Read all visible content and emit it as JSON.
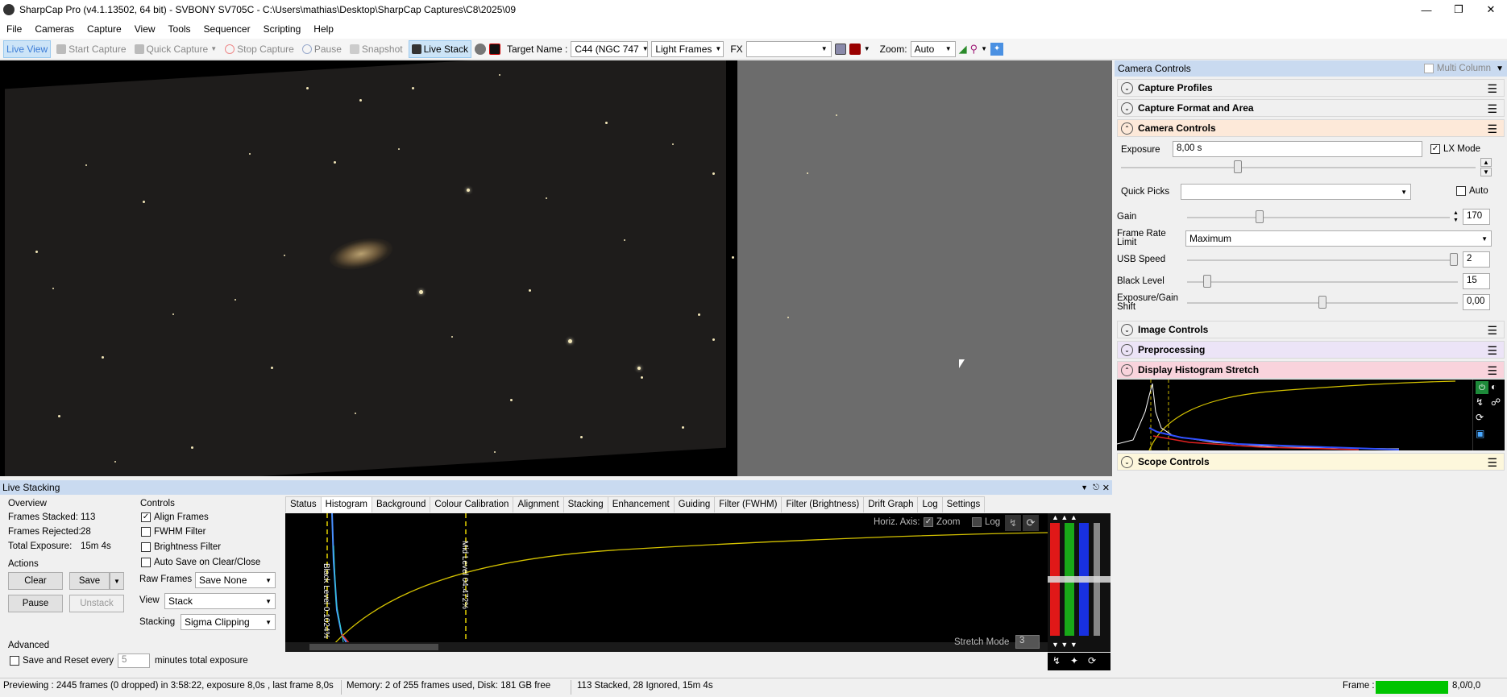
{
  "window": {
    "title": "SharpCap Pro (v4.1.13502, 64 bit) - SVBONY SV705C - C:\\Users\\mathias\\Desktop\\SharpCap Captures\\C8\\2025\\09"
  },
  "menu": [
    "File",
    "Cameras",
    "Capture",
    "View",
    "Tools",
    "Sequencer",
    "Scripting",
    "Help"
  ],
  "toolbar": {
    "live_view": "Live View",
    "start_capture": "Start Capture",
    "quick_capture": "Quick Capture",
    "stop_capture": "Stop Capture",
    "pause": "Pause",
    "snapshot": "Snapshot",
    "live_stack": "Live Stack",
    "target_label": "Target Name :",
    "target_value": "C44 (NGC 747",
    "frame_type": "Light Frames",
    "fx_label": "FX",
    "fx_value": "",
    "zoom_label": "Zoom:",
    "zoom_value": "Auto"
  },
  "right_panel": {
    "header": "Camera Controls",
    "multi_column": "Multi Column",
    "sections": {
      "capture_profiles": "Capture Profiles",
      "capture_format": "Capture Format and Area",
      "camera_controls": "Camera Controls",
      "image_controls": "Image Controls",
      "preprocessing": "Preprocessing",
      "display_histogram": "Display Histogram Stretch",
      "scope_controls": "Scope Controls"
    },
    "exposure": {
      "label": "Exposure",
      "value": "8,00 s",
      "lx_mode": "LX Mode"
    },
    "quick_picks": {
      "label": "Quick Picks",
      "value": "",
      "auto": "Auto"
    },
    "gain": {
      "label": "Gain",
      "value": "170",
      "level": 0.26
    },
    "frame_rate": {
      "label": "Frame Rate Limit",
      "value": "Maximum"
    },
    "usb_speed": {
      "label": "USB Speed",
      "value": "2",
      "level": 1.0
    },
    "black_level": {
      "label": "Black Level",
      "value": "15",
      "level": 0.06
    },
    "exposure_gain_shift": {
      "label": "Exposure/Gain Shift",
      "value": "0,00",
      "level": 0.5
    }
  },
  "live_stacking": {
    "title": "Live Stacking",
    "overview": {
      "heading": "Overview",
      "frames_stacked_label": "Frames Stacked:",
      "frames_stacked": "113",
      "frames_rejected_label": "Frames Rejected:",
      "frames_rejected": "28",
      "total_exposure_label": "Total Exposure:",
      "total_exposure": "15m 4s"
    },
    "actions": {
      "heading": "Actions",
      "clear": "Clear",
      "save": "Save",
      "pause": "Pause",
      "unstack": "Unstack"
    },
    "advanced": {
      "heading": "Advanced",
      "save_reset": "Save and Reset every",
      "minutes_value": "5",
      "minutes_label": "minutes total exposure"
    },
    "controls": {
      "heading": "Controls",
      "align_frames": "Align Frames",
      "fwhm_filter": "FWHM Filter",
      "brightness_filter": "Brightness Filter",
      "auto_save": "Auto Save on Clear/Close",
      "raw_frames_label": "Raw Frames",
      "raw_frames_value": "Save None",
      "view_label": "View",
      "view_value": "Stack",
      "stacking_label": "Stacking",
      "stacking_value": "Sigma Clipping"
    },
    "tabs": [
      "Status",
      "Histogram",
      "Background",
      "Colour Calibration",
      "Alignment",
      "Stacking",
      "Enhancement",
      "Guiding",
      "Filter (FWHM)",
      "Filter (Brightness)",
      "Drift Graph",
      "Log",
      "Settings"
    ],
    "active_tab": "Histogram",
    "histogram": {
      "horiz_axis": "Horiz. Axis:",
      "zoom": "Zoom",
      "log": "Log",
      "black_level": "Black Level 0.1024%",
      "mid_level": "Mid Level 04.472%",
      "stretch_mode_label": "Stretch Mode",
      "stretch_mode_value": "3"
    }
  },
  "status": {
    "preview": "Previewing : 2445 frames (0 dropped) in 3:58:22, exposure 8,0s , last frame 8,0s",
    "memory": "Memory: 2 of 255 frames used, Disk: 181 GB free",
    "stack": "113 Stacked, 28 Ignored, 15m 4s",
    "frame_label": "Frame :",
    "frame_value": "8,0/0,0"
  },
  "colors": {
    "accent": "#c9daf0",
    "camera_controls_bg": "#fde9d9",
    "preprocessing_bg": "#ece4f7",
    "display_histogram_bg": "#f9d3dc",
    "scope_controls_bg": "#fdf7dc",
    "frame_bar": "#00c400"
  }
}
